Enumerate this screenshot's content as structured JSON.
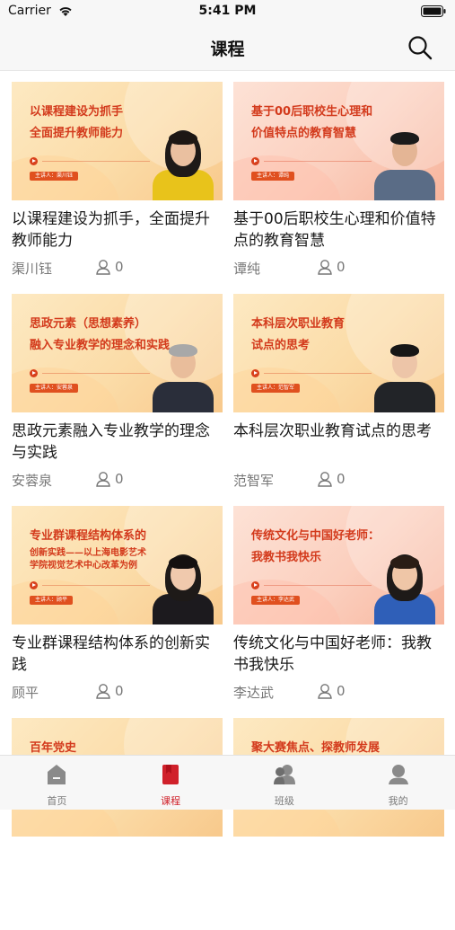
{
  "status_bar": {
    "carrier": "Carrier",
    "time": "5:41 PM"
  },
  "nav": {
    "title": "课程"
  },
  "courses": [
    {
      "thumb_lines": [
        "以课程建设为抓手",
        "全面提升教师能力"
      ],
      "presenter_tag": "主讲人：渠川钰",
      "title": "以课程建设为抓手，全面提升教师能力",
      "teacher": "渠川钰",
      "count": "0",
      "theme": "yellow"
    },
    {
      "thumb_lines": [
        "基于00后职校生心理和",
        "价值特点的教育智慧"
      ],
      "presenter_tag": "主讲人：谭纯",
      "title": "基于00后职校生心理和价值特点的教育智慧",
      "teacher": "谭纯",
      "count": "0",
      "theme": "pink"
    },
    {
      "thumb_lines": [
        "思政元素（思想素养）",
        "融入专业教学的理念和实践"
      ],
      "presenter_tag": "主讲人：安蓉泉",
      "title": "思政元素融入专业教学的理念与实践",
      "teacher": "安蓉泉",
      "count": "0",
      "theme": "yellow"
    },
    {
      "thumb_lines": [
        "本科层次职业教育",
        "试点的思考"
      ],
      "presenter_tag": "主讲人：范智军",
      "title": "本科层次职业教育试点的思考",
      "teacher": "范智军",
      "count": "0",
      "theme": "yellow"
    },
    {
      "thumb_lines": [
        "专业群课程结构体系的",
        "创新实践——以上海电影艺术",
        "学院视觉艺术中心改革为例"
      ],
      "presenter_tag": "主讲人：顾平",
      "title": "专业群课程结构体系的创新实践",
      "teacher": "顾平",
      "count": "0",
      "theme": "yellow"
    },
    {
      "thumb_lines": [
        "传统文化与中国好老师：",
        "我教书我快乐"
      ],
      "presenter_tag": "主讲人：李达武",
      "title": "传统文化与中国好老师：我教书我快乐",
      "teacher": "李达武",
      "count": "0",
      "theme": "pink"
    },
    {
      "thumb_lines": [
        "百年党史"
      ],
      "presenter_tag": "",
      "title": "",
      "teacher": "",
      "count": "",
      "theme": "yellow"
    },
    {
      "thumb_lines": [
        "聚大赛焦点、探教师发展"
      ],
      "presenter_tag": "",
      "title": "",
      "teacher": "",
      "count": "",
      "theme": "yellow"
    }
  ],
  "tabs": [
    {
      "label": "首页",
      "icon": "home-icon",
      "active": false
    },
    {
      "label": "课程",
      "icon": "book-icon",
      "active": true
    },
    {
      "label": "班级",
      "icon": "class-icon",
      "active": false
    },
    {
      "label": "我的",
      "icon": "profile-icon",
      "active": false
    }
  ],
  "colors": {
    "accent": "#d0202a",
    "thumb_title": "#d33a1c",
    "inactive_tab": "#7a7a7a"
  }
}
